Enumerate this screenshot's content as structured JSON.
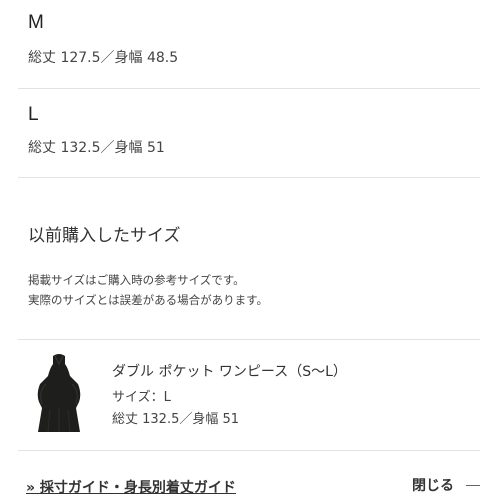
{
  "sizes": [
    {
      "letter": "M",
      "spec": "総丈 127.5／身幅 48.5"
    },
    {
      "letter": "L",
      "spec": "総丈 132.5／身幅 51"
    }
  ],
  "previous": {
    "title": "以前購入したサイズ",
    "note_line1": "掲載サイズはご購入時の参考サイズです。",
    "note_line2": "実際のサイズとは誤差がある場合があります。"
  },
  "product": {
    "name": "ダブル ポケット ワンピース（S〜L）",
    "size": "サイズ：L",
    "spec": "総丈 132.5／身幅 51",
    "image_icon": "dress-image"
  },
  "footer": {
    "guide_link": "» 採寸ガイド・身長別着丈ガイド",
    "close_label": "閉じる"
  }
}
